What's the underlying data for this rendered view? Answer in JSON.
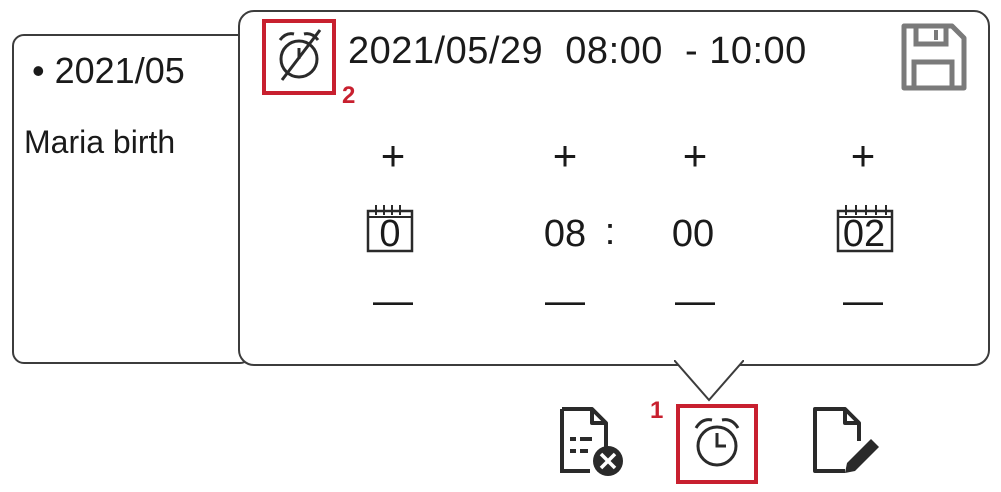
{
  "background_event": {
    "date_text": "• 2021/05",
    "title_text": "Maria birth"
  },
  "popup": {
    "range_text": "2021/05/29  08:00  - 10:00",
    "step_labels": {
      "plus": "+",
      "minus": "—"
    },
    "day_value": "0",
    "hour_value": "08",
    "separator": ":",
    "minute_value": "00",
    "duration_value": "02",
    "marker_2": "2"
  },
  "toolbar": {
    "marker_1": "1"
  },
  "icons": {
    "clear_time": "alarm-off-icon",
    "save": "floppy-disk-icon",
    "day_calendar": "calendar-icon",
    "duration_calendar": "calendar-icon",
    "delete_note": "note-delete-icon",
    "alarm": "alarm-clock-icon",
    "edit_note": "note-edit-icon"
  },
  "colors": {
    "highlight": "#c8202f",
    "ink": "#1a1a1a"
  }
}
